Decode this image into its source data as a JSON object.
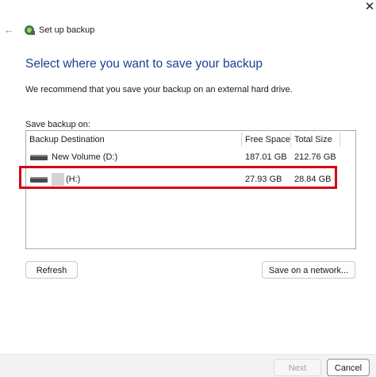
{
  "window": {
    "title": "Set up backup",
    "close_glyph": "✕",
    "back_glyph": "←"
  },
  "main": {
    "heading": "Select where you want to save your backup",
    "recommendation": "We recommend that you save your backup on an external hard drive.",
    "save_on_label": "Save backup on:"
  },
  "table": {
    "columns": [
      "Backup Destination",
      "Free Space",
      "Total Size"
    ],
    "rows": [
      {
        "destination": "New Volume (D:)",
        "free_space": "187.01 GB",
        "total_size": "212.76 GB",
        "icon": "drive-icon"
      },
      {
        "destination": "(H:)",
        "free_space": "27.93 GB",
        "total_size": "28.84 GB",
        "icon": "drive-icon"
      }
    ]
  },
  "buttons": {
    "refresh": "Refresh",
    "save_network": "Save on a network...",
    "next": "Next",
    "cancel": "Cancel"
  },
  "colors": {
    "heading": "#1c3f94",
    "highlight": "#d40014"
  }
}
